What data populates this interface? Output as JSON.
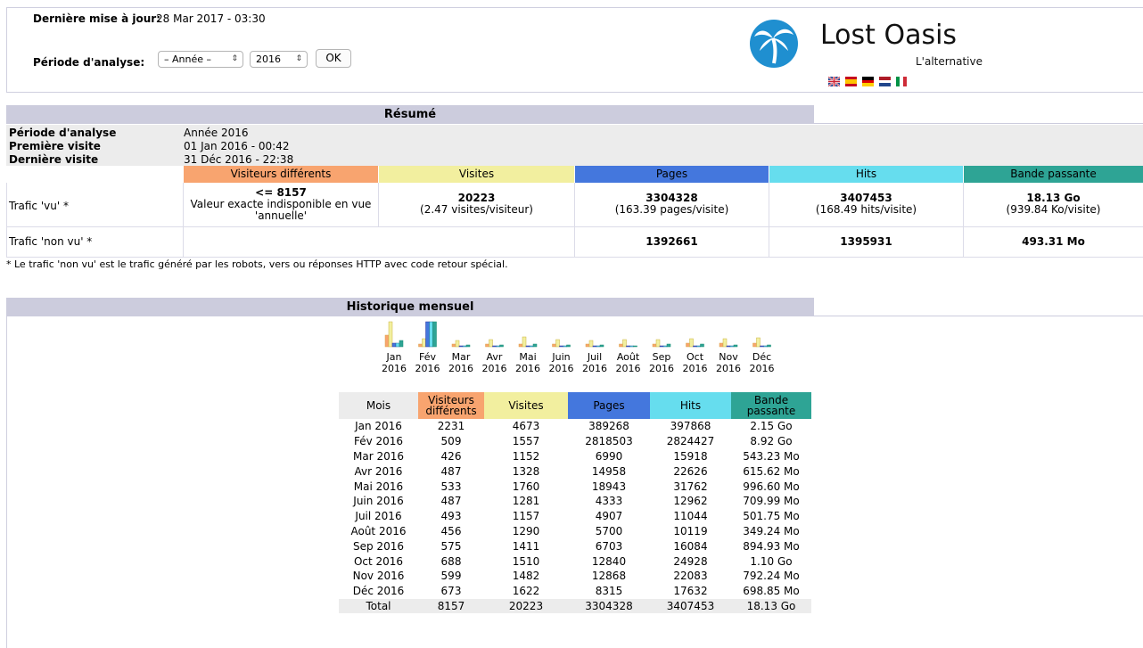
{
  "header": {
    "last_update_label": "Dernière mise à jour:",
    "last_update_value": "28 Mar 2017 - 03:30",
    "period_label": "Période d'analyse:",
    "period_select_value": "– Année –",
    "year_select_value": "2016",
    "ok_label": "OK",
    "logo_title": "Lost Oasis",
    "logo_subtitle": "L'alternative",
    "flags": [
      "english-flag-icon",
      "spanish-flag-icon",
      "german-flag-icon",
      "dutch-flag-icon",
      "italian-flag-icon"
    ]
  },
  "colors": {
    "visitors": "#f8a46f",
    "visits": "#f2ef9f",
    "pages": "#4477dd",
    "hits": "#66ddee",
    "bandwidth": "#2ea495",
    "title_bar": "#ccccdd",
    "info_bg": "#ececec"
  },
  "summary": {
    "title": "Résumé",
    "info": [
      {
        "label": "Période d'analyse",
        "value": "Année 2016"
      },
      {
        "label": "Première visite",
        "value": "01 Jan 2016 - 00:42"
      },
      {
        "label": "Dernière visite",
        "value": "31 Déc 2016 - 22:38"
      }
    ],
    "columns": [
      "Visiteurs différents",
      "Visites",
      "Pages",
      "Hits",
      "Bande passante"
    ],
    "seen": {
      "label": "Trafic 'vu' *",
      "visitors_main": "<= 8157",
      "visitors_sub": "Valeur exacte indisponible en vue 'annuelle'",
      "visits_main": "20223",
      "visits_sub": "(2.47 visites/visiteur)",
      "pages_main": "3304328",
      "pages_sub": "(163.39 pages/visite)",
      "hits_main": "3407453",
      "hits_sub": "(168.49 hits/visite)",
      "bandwidth_main": "18.13 Go",
      "bandwidth_sub": "(939.84 Ko/visite)"
    },
    "unseen": {
      "label": "Trafic 'non vu' *",
      "pages": "1392661",
      "hits": "1395931",
      "bandwidth": "493.31 Mo"
    },
    "footnote": "* Le trafic 'non vu' est le trafic généré par les robots, vers ou réponses HTTP avec code retour spécial."
  },
  "monthly": {
    "title": "Historique mensuel",
    "chart_months": [
      {
        "m": "Jan",
        "y": "2016"
      },
      {
        "m": "Fév",
        "y": "2016"
      },
      {
        "m": "Mar",
        "y": "2016"
      },
      {
        "m": "Avr",
        "y": "2016"
      },
      {
        "m": "Mai",
        "y": "2016"
      },
      {
        "m": "Juin",
        "y": "2016"
      },
      {
        "m": "Juil",
        "y": "2016"
      },
      {
        "m": "Août",
        "y": "2016"
      },
      {
        "m": "Sep",
        "y": "2016"
      },
      {
        "m": "Oct",
        "y": "2016"
      },
      {
        "m": "Nov",
        "y": "2016"
      },
      {
        "m": "Déc",
        "y": "2016"
      }
    ],
    "table_headers": [
      "Mois",
      "Visiteurs différents",
      "Visites",
      "Pages",
      "Hits",
      "Bande passante"
    ],
    "rows": [
      [
        "Jan 2016",
        "2231",
        "4673",
        "389268",
        "397868",
        "2.15 Go"
      ],
      [
        "Fév 2016",
        "509",
        "1557",
        "2818503",
        "2824427",
        "8.92 Go"
      ],
      [
        "Mar 2016",
        "426",
        "1152",
        "6990",
        "15918",
        "543.23 Mo"
      ],
      [
        "Avr 2016",
        "487",
        "1328",
        "14958",
        "22626",
        "615.62 Mo"
      ],
      [
        "Mai 2016",
        "533",
        "1760",
        "18943",
        "31762",
        "996.60 Mo"
      ],
      [
        "Juin 2016",
        "487",
        "1281",
        "4333",
        "12962",
        "709.99 Mo"
      ],
      [
        "Juil 2016",
        "493",
        "1157",
        "4907",
        "11044",
        "501.75 Mo"
      ],
      [
        "Août 2016",
        "456",
        "1290",
        "5700",
        "10119",
        "349.24 Mo"
      ],
      [
        "Sep 2016",
        "575",
        "1411",
        "6703",
        "16084",
        "894.93 Mo"
      ],
      [
        "Oct 2016",
        "688",
        "1510",
        "12840",
        "24928",
        "1.10 Go"
      ],
      [
        "Nov 2016",
        "599",
        "1482",
        "12868",
        "22083",
        "792.24 Mo"
      ],
      [
        "Déc 2016",
        "673",
        "1622",
        "8315",
        "17632",
        "698.85 Mo"
      ]
    ],
    "total": [
      "Total",
      "8157",
      "20223",
      "3304328",
      "3407453",
      "18.13 Go"
    ]
  },
  "chart_data": {
    "type": "bar",
    "categories": [
      "Jan 2016",
      "Fév 2016",
      "Mar 2016",
      "Avr 2016",
      "Mai 2016",
      "Juin 2016",
      "Juil 2016",
      "Août 2016",
      "Sep 2016",
      "Oct 2016",
      "Nov 2016",
      "Déc 2016"
    ],
    "series": [
      {
        "name": "Visiteurs différents",
        "values": [
          2231,
          509,
          426,
          487,
          533,
          487,
          493,
          456,
          575,
          688,
          599,
          673
        ]
      },
      {
        "name": "Visites",
        "values": [
          4673,
          1557,
          1152,
          1328,
          1760,
          1281,
          1157,
          1290,
          1411,
          1510,
          1482,
          1622
        ]
      },
      {
        "name": "Pages",
        "values": [
          389268,
          2818503,
          6990,
          14958,
          18943,
          4333,
          4907,
          5700,
          6703,
          12840,
          12868,
          8315
        ]
      },
      {
        "name": "Hits",
        "values": [
          397868,
          2824427,
          15918,
          22626,
          31762,
          12962,
          11044,
          10119,
          16084,
          24928,
          22083,
          17632
        ]
      },
      {
        "name": "Bande passante",
        "values": [
          2.15,
          8.92,
          0.54323,
          0.61562,
          0.9966,
          0.70999,
          0.50175,
          0.34924,
          0.89493,
          1.1,
          0.79224,
          0.69885
        ]
      }
    ]
  }
}
